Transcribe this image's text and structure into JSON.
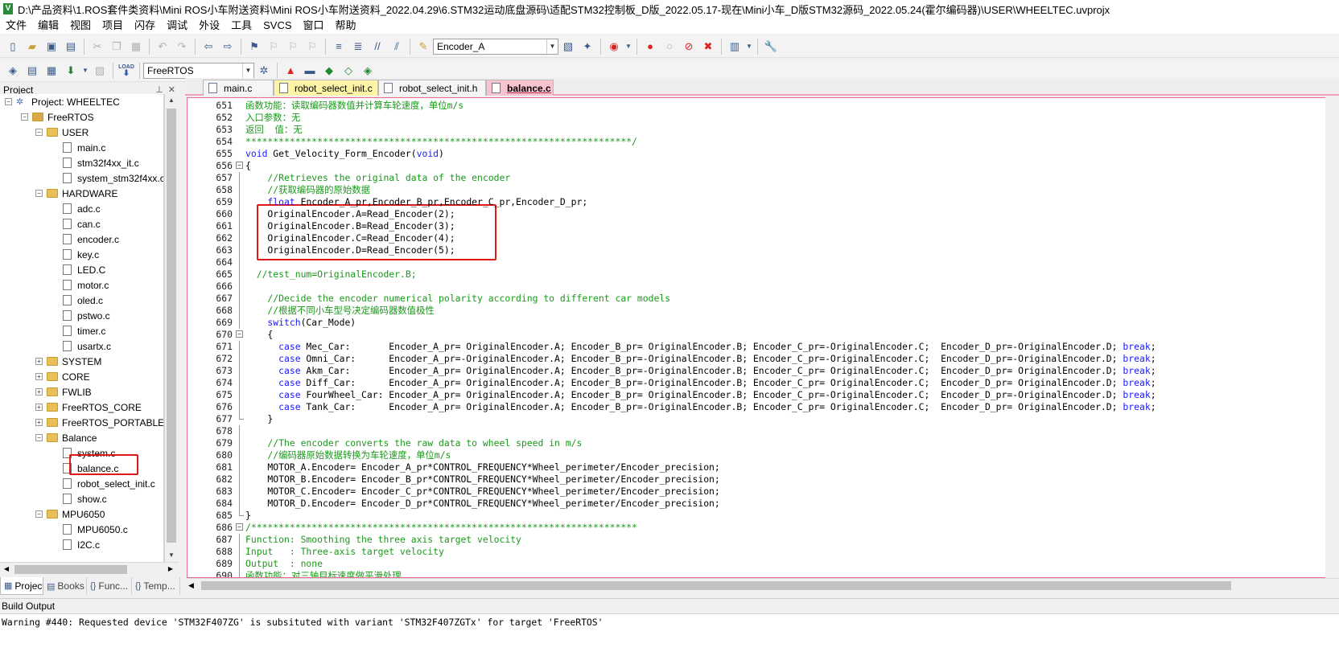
{
  "window": {
    "title": "D:\\产品资料\\1.ROS套件类资料\\Mini ROS小车附送资料\\Mini ROS小车附送资料_2022.04.29\\6.STM32运动底盘源码\\适配STM32控制板_D版_2022.05.17-现在\\Mini小车_D版STM32源码_2022.05.24(霍尔编码器)\\USER\\WHEELTEC.uvprojx",
    "app_icon": "V"
  },
  "menu": [
    "文件",
    "编辑",
    "视图",
    "项目",
    "闪存",
    "调试",
    "外设",
    "工具",
    "SVCS",
    "窗口",
    "帮助"
  ],
  "toolbar": {
    "find_combo_value": "Encoder_A",
    "target_combo_value": "FreeRTOS",
    "load_label": "LOAD"
  },
  "project_panel": {
    "title": "Project",
    "tree": [
      {
        "label": "Project: WHEELTEC",
        "type": "project",
        "expander": "−"
      },
      {
        "label": "FreeRTOS",
        "type": "target",
        "expander": "−"
      },
      {
        "label": "USER",
        "type": "folder",
        "expander": "−"
      },
      {
        "label": "main.c",
        "type": "file"
      },
      {
        "label": "stm32f4xx_it.c",
        "type": "file"
      },
      {
        "label": "system_stm32f4xx.c",
        "type": "file"
      },
      {
        "label": "HARDWARE",
        "type": "folder",
        "expander": "−"
      },
      {
        "label": "adc.c",
        "type": "file"
      },
      {
        "label": "can.c",
        "type": "file"
      },
      {
        "label": "encoder.c",
        "type": "file"
      },
      {
        "label": "key.c",
        "type": "file"
      },
      {
        "label": "LED.C",
        "type": "file"
      },
      {
        "label": "motor.c",
        "type": "file"
      },
      {
        "label": "oled.c",
        "type": "file"
      },
      {
        "label": "pstwo.c",
        "type": "file"
      },
      {
        "label": "timer.c",
        "type": "file"
      },
      {
        "label": "usartx.c",
        "type": "file"
      },
      {
        "label": "SYSTEM",
        "type": "folder",
        "expander": "+"
      },
      {
        "label": "CORE",
        "type": "folder",
        "expander": "+"
      },
      {
        "label": "FWLIB",
        "type": "folder",
        "expander": "+"
      },
      {
        "label": "FreeRTOS_CORE",
        "type": "folder",
        "expander": "+"
      },
      {
        "label": "FreeRTOS_PORTABLE",
        "type": "folder",
        "expander": "+"
      },
      {
        "label": "Balance",
        "type": "folder",
        "expander": "−"
      },
      {
        "label": "system.c",
        "type": "file"
      },
      {
        "label": "balance.c",
        "type": "file",
        "highlighted": true
      },
      {
        "label": "robot_select_init.c",
        "type": "file"
      },
      {
        "label": "show.c",
        "type": "file"
      },
      {
        "label": "MPU6050",
        "type": "folder",
        "expander": "−"
      },
      {
        "label": "MPU6050.c",
        "type": "file"
      },
      {
        "label": "I2C.c",
        "type": "file"
      }
    ],
    "bottom_tabs": [
      {
        "label": "Project",
        "icon": "project-icon",
        "active": true
      },
      {
        "label": "Books",
        "icon": "books-icon"
      },
      {
        "label": "Func...",
        "icon": "functions-icon"
      },
      {
        "label": "Temp...",
        "icon": "templates-icon"
      }
    ]
  },
  "editor": {
    "tabs": [
      {
        "label": "main.c",
        "style": "normal"
      },
      {
        "label": "robot_select_init.c",
        "style": "yellow"
      },
      {
        "label": "robot_select_init.h",
        "style": "normal"
      },
      {
        "label": "balance.c",
        "style": "active"
      }
    ],
    "lines": [
      {
        "n": "651",
        "f": "",
        "s": [
          [
            "c",
            "函数功能：读取编码器数值并计算车轮速度，单位m/s"
          ]
        ]
      },
      {
        "n": "652",
        "f": "",
        "s": [
          [
            "c",
            "入口参数：无"
          ]
        ]
      },
      {
        "n": "653",
        "f": "",
        "s": [
          [
            "c",
            "返回  值：无"
          ]
        ]
      },
      {
        "n": "654",
        "f": "",
        "s": [
          [
            "c",
            "**********************************************************************/"
          ]
        ]
      },
      {
        "n": "655",
        "f": "",
        "s": [
          [
            "k",
            "void"
          ],
          [
            "d",
            " Get_Velocity_Form_Encoder("
          ],
          [
            "k",
            "void"
          ],
          [
            "d",
            ")"
          ]
        ]
      },
      {
        "n": "656",
        "f": "open",
        "s": [
          [
            "d",
            "{"
          ]
        ]
      },
      {
        "n": "657",
        "f": "line",
        "s": [
          [
            "c",
            "    //Retrieves the original data of the encoder"
          ]
        ]
      },
      {
        "n": "658",
        "f": "line",
        "s": [
          [
            "c",
            "    //获取编码器的原始数据"
          ]
        ]
      },
      {
        "n": "659",
        "f": "line",
        "s": [
          [
            "k",
            "    float"
          ],
          [
            "d",
            " Encoder_A_pr,Encoder_B_pr,Encoder_C_pr,Encoder_D_pr;"
          ]
        ]
      },
      {
        "n": "660",
        "f": "line",
        "s": [
          [
            "d",
            "    OriginalEncoder.A=Read_Encoder(2);"
          ]
        ]
      },
      {
        "n": "661",
        "f": "line",
        "s": [
          [
            "d",
            "    OriginalEncoder.B=Read_Encoder(3);"
          ]
        ]
      },
      {
        "n": "662",
        "f": "line",
        "s": [
          [
            "d",
            "    OriginalEncoder.C=Read_Encoder(4);"
          ]
        ]
      },
      {
        "n": "663",
        "f": "line",
        "s": [
          [
            "d",
            "    OriginalEncoder.D=Read_Encoder(5);"
          ]
        ]
      },
      {
        "n": "664",
        "f": "line",
        "s": [
          [
            "d",
            ""
          ]
        ]
      },
      {
        "n": "665",
        "f": "line",
        "s": [
          [
            "c",
            "  //test_num=OriginalEncoder.B;"
          ]
        ]
      },
      {
        "n": "666",
        "f": "line",
        "s": [
          [
            "d",
            ""
          ]
        ]
      },
      {
        "n": "667",
        "f": "line",
        "s": [
          [
            "c",
            "    //Decide the encoder numerical polarity according to different car models"
          ]
        ]
      },
      {
        "n": "668",
        "f": "line",
        "s": [
          [
            "c",
            "    //根据不同小车型号决定编码器数值极性"
          ]
        ]
      },
      {
        "n": "669",
        "f": "line",
        "s": [
          [
            "k",
            "    switch"
          ],
          [
            "d",
            "(Car_Mode)"
          ]
        ]
      },
      {
        "n": "670",
        "f": "open",
        "s": [
          [
            "d",
            "    {"
          ]
        ]
      },
      {
        "n": "671",
        "f": "line",
        "s": [
          [
            "k",
            "      case"
          ],
          [
            "d",
            " Mec_Car:       Encoder_A_pr= OriginalEncoder.A; Encoder_B_pr= OriginalEncoder.B; Encoder_C_pr=-OriginalEncoder.C;  Encoder_D_pr=-OriginalEncoder.D; "
          ],
          [
            "k",
            "break"
          ],
          [
            "d",
            ";"
          ]
        ]
      },
      {
        "n": "672",
        "f": "line",
        "s": [
          [
            "k",
            "      case"
          ],
          [
            "d",
            " Omni_Car:      Encoder_A_pr=-OriginalEncoder.A; Encoder_B_pr=-OriginalEncoder.B; Encoder_C_pr=-OriginalEncoder.C;  Encoder_D_pr=-OriginalEncoder.D; "
          ],
          [
            "k",
            "break"
          ],
          [
            "d",
            ";"
          ]
        ]
      },
      {
        "n": "673",
        "f": "line",
        "s": [
          [
            "k",
            "      case"
          ],
          [
            "d",
            " Akm_Car:       Encoder_A_pr= OriginalEncoder.A; Encoder_B_pr=-OriginalEncoder.B; Encoder_C_pr= OriginalEncoder.C;  Encoder_D_pr= OriginalEncoder.D; "
          ],
          [
            "k",
            "break"
          ],
          [
            "d",
            ";"
          ]
        ]
      },
      {
        "n": "674",
        "f": "line",
        "s": [
          [
            "k",
            "      case"
          ],
          [
            "d",
            " Diff_Car:      Encoder_A_pr= OriginalEncoder.A; Encoder_B_pr=-OriginalEncoder.B; Encoder_C_pr= OriginalEncoder.C;  Encoder_D_pr= OriginalEncoder.D; "
          ],
          [
            "k",
            "break"
          ],
          [
            "d",
            ";"
          ]
        ]
      },
      {
        "n": "675",
        "f": "line",
        "s": [
          [
            "k",
            "      case"
          ],
          [
            "d",
            " FourWheel_Car: Encoder_A_pr= OriginalEncoder.A; Encoder_B_pr= OriginalEncoder.B; Encoder_C_pr=-OriginalEncoder.C;  Encoder_D_pr=-OriginalEncoder.D; "
          ],
          [
            "k",
            "break"
          ],
          [
            "d",
            ";"
          ]
        ]
      },
      {
        "n": "676",
        "f": "line",
        "s": [
          [
            "k",
            "      case"
          ],
          [
            "d",
            " Tank_Car:      Encoder_A_pr= OriginalEncoder.A; Encoder_B_pr=-OriginalEncoder.B; Encoder_C_pr= OriginalEncoder.C;  Encoder_D_pr= OriginalEncoder.D; "
          ],
          [
            "k",
            "break"
          ],
          [
            "d",
            ";"
          ]
        ]
      },
      {
        "n": "677",
        "f": "end",
        "s": [
          [
            "d",
            "    }"
          ]
        ]
      },
      {
        "n": "678",
        "f": "line",
        "s": [
          [
            "d",
            ""
          ]
        ]
      },
      {
        "n": "679",
        "f": "line",
        "s": [
          [
            "c",
            "    //The encoder converts the raw data to wheel speed in m/s"
          ]
        ]
      },
      {
        "n": "680",
        "f": "line",
        "s": [
          [
            "c",
            "    //编码器原始数据转换为车轮速度，单位m/s"
          ]
        ]
      },
      {
        "n": "681",
        "f": "line",
        "s": [
          [
            "d",
            "    MOTOR_A.Encoder= Encoder_A_pr*CONTROL_FREQUENCY*Wheel_perimeter/Encoder_precision;"
          ]
        ]
      },
      {
        "n": "682",
        "f": "line",
        "s": [
          [
            "d",
            "    MOTOR_B.Encoder= Encoder_B_pr*CONTROL_FREQUENCY*Wheel_perimeter/Encoder_precision;"
          ]
        ]
      },
      {
        "n": "683",
        "f": "line",
        "s": [
          [
            "d",
            "    MOTOR_C.Encoder= Encoder_C_pr*CONTROL_FREQUENCY*Wheel_perimeter/Encoder_precision;"
          ]
        ]
      },
      {
        "n": "684",
        "f": "line",
        "s": [
          [
            "d",
            "    MOTOR_D.Encoder= Encoder_D_pr*CONTROL_FREQUENCY*Wheel_perimeter/Encoder_precision;"
          ]
        ]
      },
      {
        "n": "685",
        "f": "end",
        "s": [
          [
            "d",
            "}"
          ]
        ]
      },
      {
        "n": "686",
        "f": "open",
        "s": [
          [
            "c",
            "/**********************************************************************"
          ]
        ]
      },
      {
        "n": "687",
        "f": "line",
        "s": [
          [
            "c",
            "Function: Smoothing the three axis target velocity"
          ]
        ]
      },
      {
        "n": "688",
        "f": "line",
        "s": [
          [
            "c",
            "Input   : Three-axis target velocity"
          ]
        ]
      },
      {
        "n": "689",
        "f": "line",
        "s": [
          [
            "c",
            "Output  : none"
          ]
        ]
      },
      {
        "n": "690",
        "f": "line",
        "s": [
          [
            "c",
            "函数功能：对三轴目标速度做平滑处理"
          ]
        ]
      }
    ]
  },
  "build_output": {
    "title": "Build Output",
    "line": "Warning #440: Requested device 'STM32F407ZG' is subsituted with variant 'STM32F407ZGTx' for target 'FreeRTOS'"
  },
  "colors": {
    "comment": "#1a9a1a",
    "keyword": "#1a1aff",
    "highlight_box": "#e01818",
    "active_tab": "#f9c3d0"
  }
}
